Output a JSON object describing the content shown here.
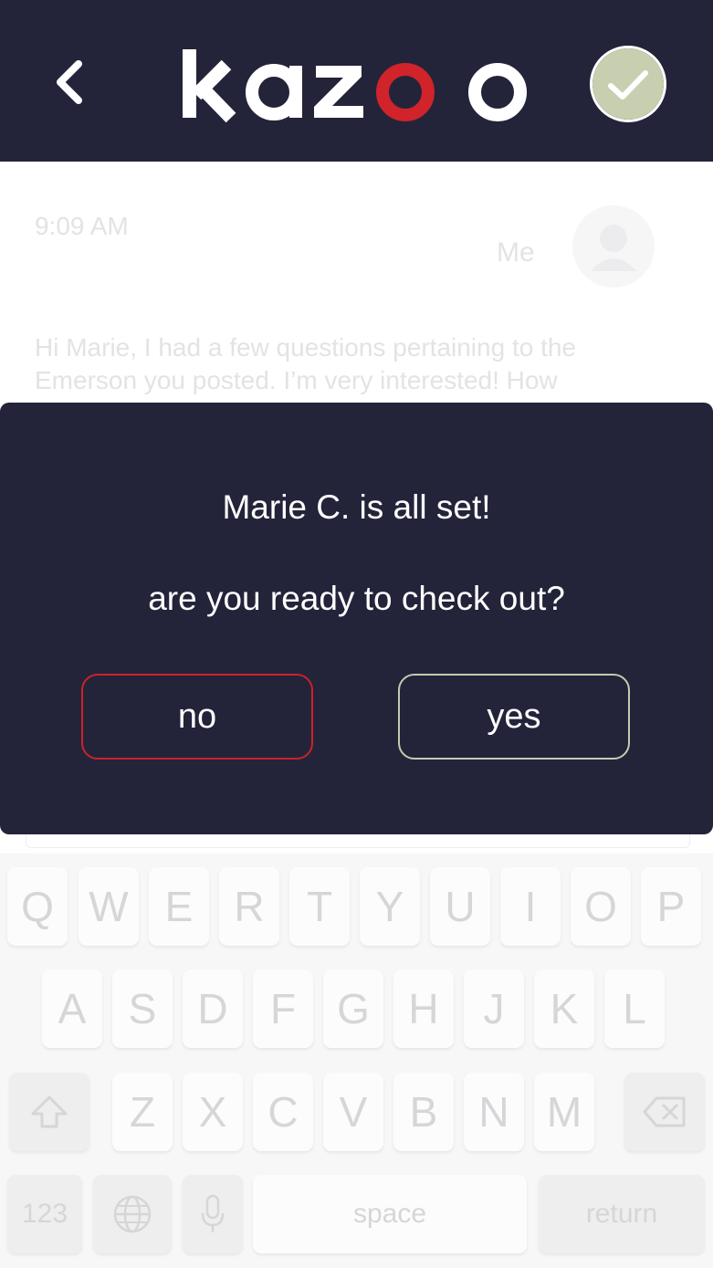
{
  "header": {
    "logo_text": "kazoo",
    "colors": {
      "background": "#23243a",
      "logo_white": "#ffffff",
      "logo_accent": "#d0232a",
      "check_fill": "#c7cfb0"
    }
  },
  "conversation": {
    "timestamp": "9:09 AM",
    "sender": "Me",
    "message_line1": "Hi Marie, I had a few questions pertaining to the",
    "message_line2": "Emerson you posted. I’m very interested! How"
  },
  "modal": {
    "title": "Marie C. is all set!",
    "question": "are you ready to check out?",
    "no_label": "no",
    "yes_label": "yes",
    "colors": {
      "no_border": "#cc2228",
      "yes_border": "#c6cbb0"
    }
  },
  "keyboard": {
    "row1": [
      "Q",
      "W",
      "E",
      "R",
      "T",
      "Y",
      "U",
      "I",
      "O",
      "P"
    ],
    "row2": [
      "A",
      "S",
      "D",
      "F",
      "G",
      "H",
      "J",
      "K",
      "L"
    ],
    "row3": [
      "Z",
      "X",
      "C",
      "V",
      "B",
      "N",
      "M"
    ],
    "numbers_label": "123",
    "space_label": "space",
    "return_label": "return"
  }
}
